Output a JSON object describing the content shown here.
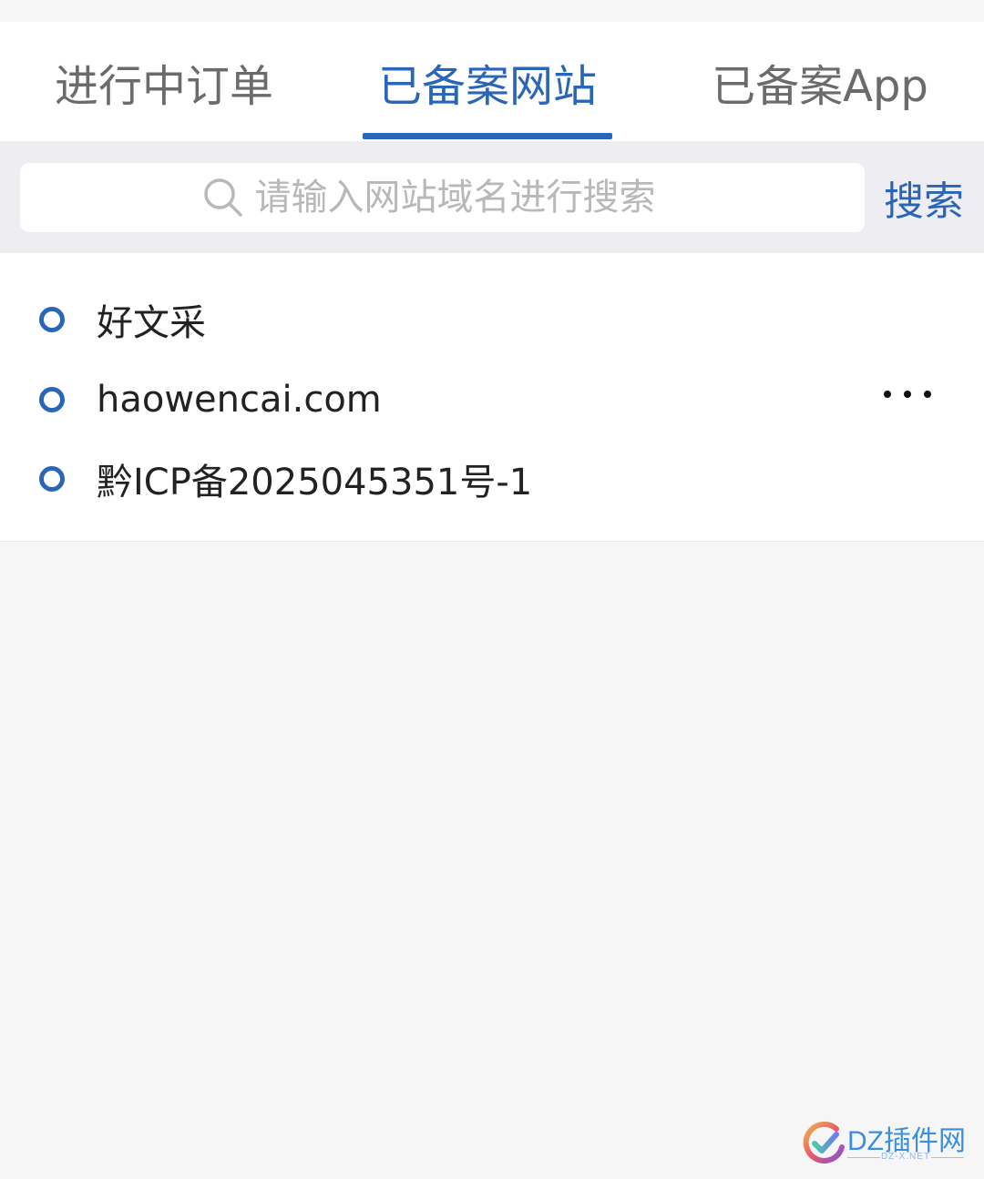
{
  "tabs": [
    {
      "label": "进行中订单",
      "active": false
    },
    {
      "label": "已备案网站",
      "active": true
    },
    {
      "label": "已备案App",
      "active": false
    }
  ],
  "search": {
    "placeholder": "请输入网站域名进行搜索",
    "value": "",
    "button_label": "搜索",
    "icon": "search-icon"
  },
  "record": {
    "site_name": "好文采",
    "domain": "haowencai.com",
    "license_number": "黔ICP备2025045351号-1",
    "more_icon": "more-horizontal-icon"
  },
  "watermark": {
    "title": "DZ插件网",
    "subtitle": "DZ-X.NET"
  },
  "colors": {
    "accent": "#2a66b8",
    "tab_inactive": "#6b6b6b",
    "page_background": "#f6f6f7",
    "search_band": "#eeeef2"
  }
}
